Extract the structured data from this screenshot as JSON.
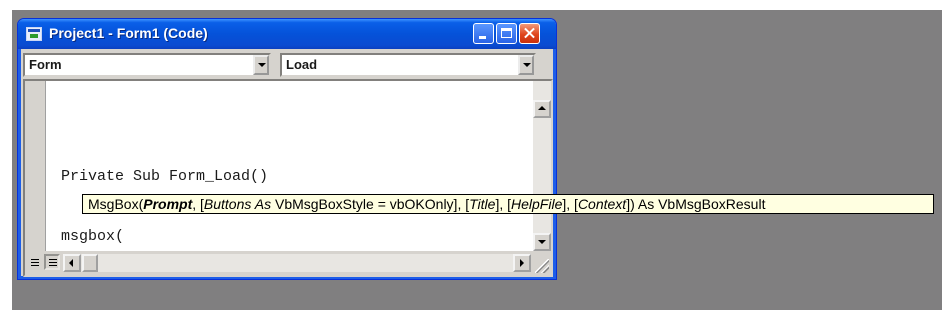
{
  "window": {
    "title": "Project1 - Form1 (Code)"
  },
  "object_combo": {
    "value": "Form"
  },
  "procedure_combo": {
    "value": "Load"
  },
  "code": {
    "lines": [
      "Private Sub Form_Load()",
      "msgbox("
    ]
  },
  "tooltip": {
    "t1": "MsgBox(",
    "t2": "Prompt",
    "t3": ", [",
    "t4": "Buttons As",
    "t5": " VbMsgBoxStyle = vbOKOnly], [",
    "t6": "Title",
    "t7": "], [",
    "t8": "HelpFile",
    "t9": "], [",
    "t10": "Context",
    "t11": "]) As VbMsgBoxResult"
  },
  "colors": {
    "desktop": "#807f80",
    "titlebar": "#0552d9",
    "tooltip_bg": "#ffffe1"
  },
  "icons": {
    "title": "vb-form-icon",
    "minimize": "minimize-icon",
    "maximize": "maximize-icon",
    "close": "close-icon"
  }
}
